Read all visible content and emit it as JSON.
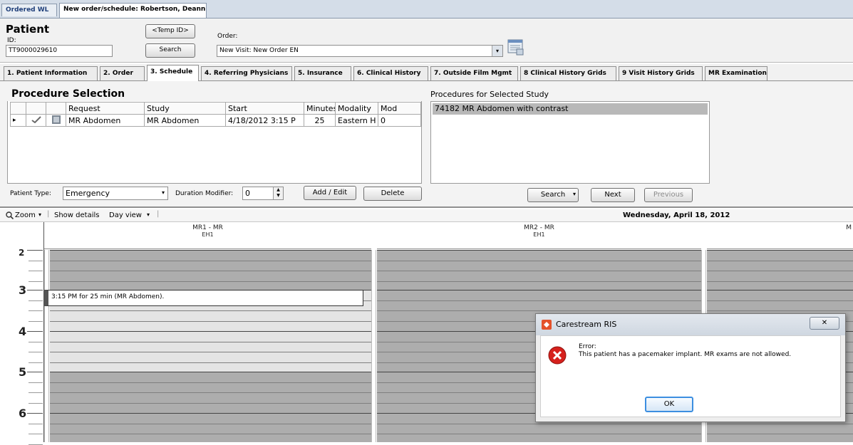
{
  "doc_tabs": [
    {
      "label": "Ordered WL"
    },
    {
      "label": "New order/schedule: Robertson, Deann"
    }
  ],
  "patient": {
    "title": "Patient",
    "id_label": "ID:",
    "id_value": "TT9000029610",
    "temp_id_button": "<Temp ID>",
    "search_button": "Search"
  },
  "order": {
    "label": "Order:",
    "value": "New Visit: New Order EN"
  },
  "section_tabs": [
    {
      "label": "1. Patient Information"
    },
    {
      "label": "2. Order"
    },
    {
      "label": "3. Schedule"
    },
    {
      "label": "4. Referring Physicians"
    },
    {
      "label": "5. Insurance"
    },
    {
      "label": "6. Clinical History"
    },
    {
      "label": "7. Outside Film Mgmt"
    },
    {
      "label": "8 Clinical History Grids"
    },
    {
      "label": "9 Visit History Grids"
    },
    {
      "label": "MR Examination"
    }
  ],
  "procedure_selection": {
    "title": "Procedure Selection",
    "columns": [
      "Request",
      "Study",
      "Start",
      "Minutes",
      "Modality",
      "Mod"
    ],
    "rows": [
      {
        "request": "MR Abdomen",
        "study": "MR Abdomen",
        "start": "4/18/2012 3:15 P",
        "minutes": "25",
        "modality": "Eastern H",
        "mod": "0"
      }
    ],
    "patient_type_label": "Patient Type:",
    "patient_type_value": "Emergency",
    "duration_modifier_label": "Duration Modifier:",
    "duration_modifier_value": "0",
    "add_edit_button": "Add / Edit",
    "delete_button": "Delete"
  },
  "procedures_for_study": {
    "title": "Procedures for Selected Study",
    "items": [
      "74182 MR Abdomen with contrast"
    ],
    "search_button": "Search",
    "next_button": "Next",
    "previous_button": "Previous"
  },
  "schedule_toolbar": {
    "zoom_label": "Zoom",
    "show_details_label": "Show details",
    "day_view_label": "Day view",
    "date": "Wednesday, April 18, 2012"
  },
  "schedule": {
    "resources": [
      {
        "name": "MR1 - MR",
        "site": "EH1"
      },
      {
        "name": "MR2 - MR",
        "site": "EH1"
      },
      {
        "name": "M",
        "site": ""
      }
    ],
    "hours": [
      "2",
      "3",
      "4",
      "5",
      "6"
    ],
    "appointment": "3:15 PM for 25 min (MR Abdomen)."
  },
  "dialog": {
    "title": "Carestream RIS",
    "close_glyph": "✕",
    "heading": "Error:",
    "message": "This patient has a pacemaker implant.  MR exams are not allowed.",
    "ok_button": "OK"
  },
  "colors": {
    "selected_row": "#b8b8b8",
    "unavailable_slot": "#adadad",
    "available_slot": "#e4e4e4",
    "error_red": "#d6201c",
    "ok_focus": "#3c8ee0"
  }
}
